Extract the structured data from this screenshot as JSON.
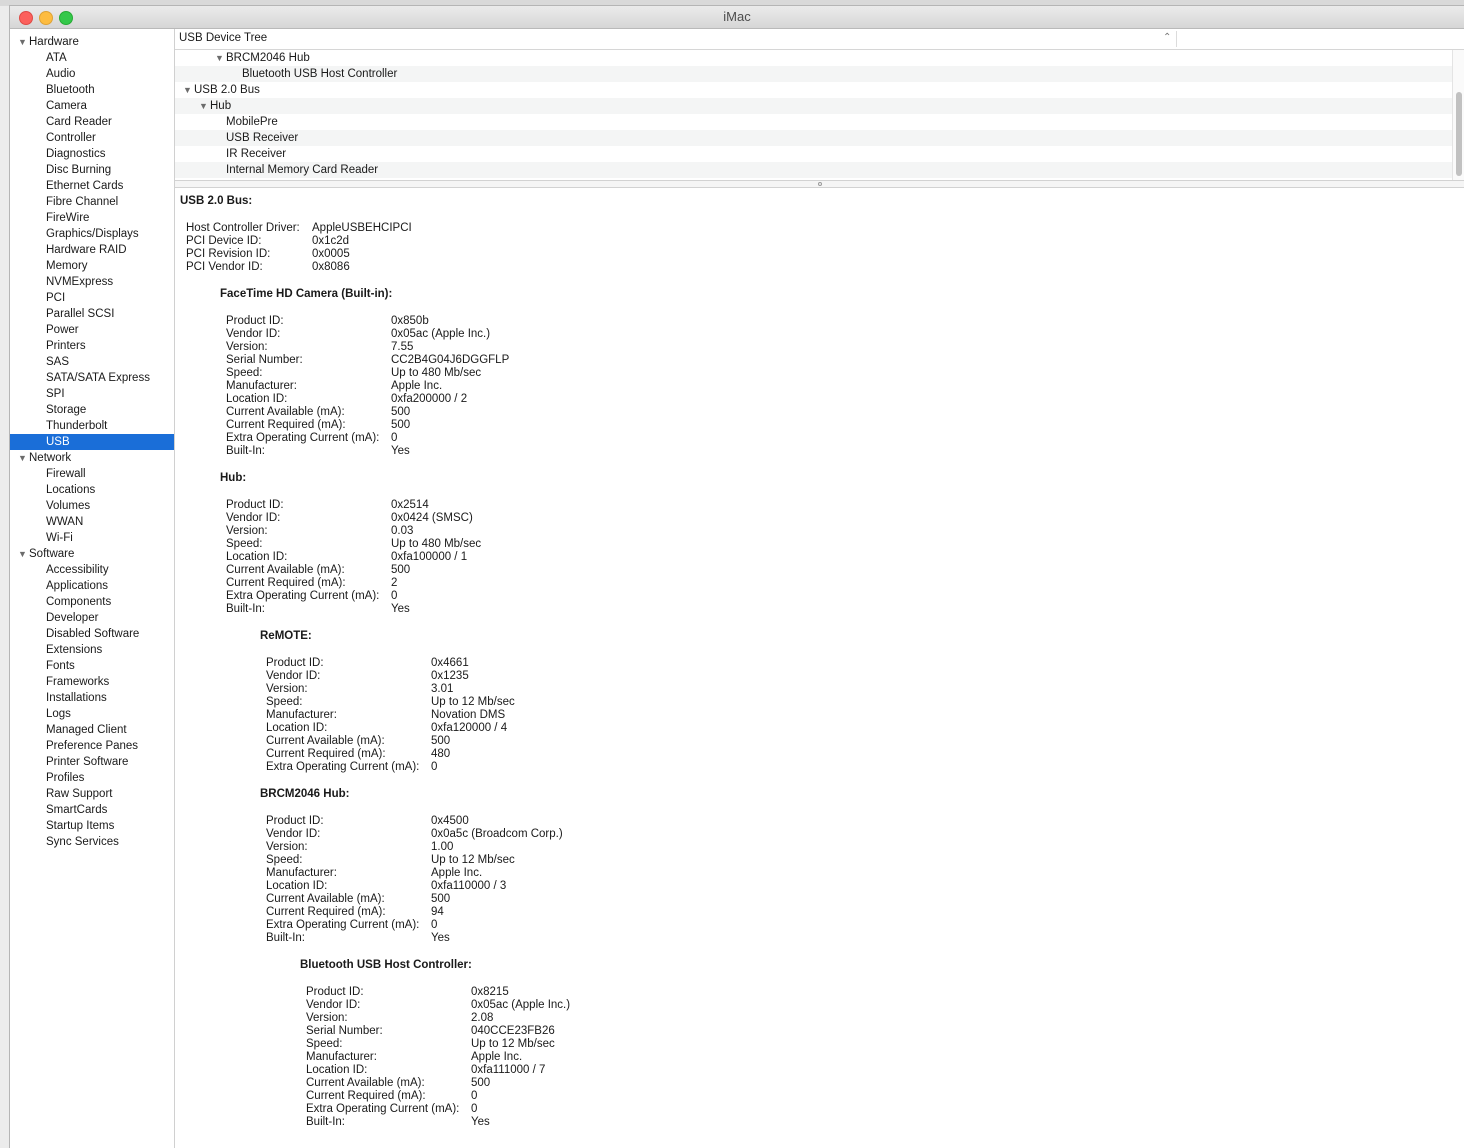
{
  "window": {
    "title": "iMac"
  },
  "sidebar": {
    "groups": [
      {
        "label": "Hardware",
        "items": [
          "ATA",
          "Audio",
          "Bluetooth",
          "Camera",
          "Card Reader",
          "Controller",
          "Diagnostics",
          "Disc Burning",
          "Ethernet Cards",
          "Fibre Channel",
          "FireWire",
          "Graphics/Displays",
          "Hardware RAID",
          "Memory",
          "NVMExpress",
          "PCI",
          "Parallel SCSI",
          "Power",
          "Printers",
          "SAS",
          "SATA/SATA Express",
          "SPI",
          "Storage",
          "Thunderbolt",
          "USB"
        ]
      },
      {
        "label": "Network",
        "items": [
          "Firewall",
          "Locations",
          "Volumes",
          "WWAN",
          "Wi-Fi"
        ]
      },
      {
        "label": "Software",
        "items": [
          "Accessibility",
          "Applications",
          "Components",
          "Developer",
          "Disabled Software",
          "Extensions",
          "Fonts",
          "Frameworks",
          "Installations",
          "Logs",
          "Managed Client",
          "Preference Panes",
          "Printer Software",
          "Profiles",
          "Raw Support",
          "SmartCards",
          "Startup Items",
          "Sync Services"
        ]
      }
    ],
    "selected": "USB"
  },
  "tree": {
    "column_title": "USB Device Tree",
    "rows": [
      {
        "label": "BRCM2046 Hub",
        "level": 2,
        "expanded": true
      },
      {
        "label": "Bluetooth USB Host Controller",
        "level": 3,
        "expanded": null
      },
      {
        "label": "USB 2.0 Bus",
        "level": 0,
        "expanded": true
      },
      {
        "label": "Hub",
        "level": 1,
        "expanded": true
      },
      {
        "label": "MobilePre",
        "level": 2,
        "expanded": null
      },
      {
        "label": "USB Receiver",
        "level": 2,
        "expanded": null
      },
      {
        "label": "IR Receiver",
        "level": 2,
        "expanded": null
      },
      {
        "label": "Internal Memory Card Reader",
        "level": 2,
        "expanded": null
      }
    ]
  },
  "detail": {
    "title": "USB 2.0 Bus:",
    "bus_fields": [
      [
        "Host Controller Driver:",
        "AppleUSBEHCIPCI"
      ],
      [
        "PCI Device ID:",
        "0x1c2d"
      ],
      [
        "PCI Revision ID:",
        "0x0005"
      ],
      [
        "PCI Vendor ID:",
        "0x8086"
      ]
    ],
    "devices": [
      {
        "name": "FaceTime HD Camera (Built-in):",
        "level": 1,
        "fields": [
          [
            "Product ID:",
            "0x850b"
          ],
          [
            "Vendor ID:",
            "0x05ac (Apple Inc.)"
          ],
          [
            "Version:",
            "7.55"
          ],
          [
            "Serial Number:",
            "CC2B4G04J6DGGFLP"
          ],
          [
            "Speed:",
            "Up to 480 Mb/sec"
          ],
          [
            "Manufacturer:",
            "Apple Inc."
          ],
          [
            "Location ID:",
            "0xfa200000 / 2"
          ],
          [
            "Current Available (mA):",
            "500"
          ],
          [
            "Current Required (mA):",
            "500"
          ],
          [
            "Extra Operating Current (mA):",
            "0"
          ],
          [
            "Built-In:",
            "Yes"
          ]
        ]
      },
      {
        "name": "Hub:",
        "level": 1,
        "fields": [
          [
            "Product ID:",
            "0x2514"
          ],
          [
            "Vendor ID:",
            "0x0424  (SMSC)"
          ],
          [
            "Version:",
            "0.03"
          ],
          [
            "Speed:",
            "Up to 480 Mb/sec"
          ],
          [
            "Location ID:",
            "0xfa100000 / 1"
          ],
          [
            "Current Available (mA):",
            "500"
          ],
          [
            "Current Required (mA):",
            "2"
          ],
          [
            "Extra Operating Current (mA):",
            "0"
          ],
          [
            "Built-In:",
            "Yes"
          ]
        ]
      },
      {
        "name": "ReMOTE:",
        "level": 2,
        "fields": [
          [
            "Product ID:",
            "0x4661"
          ],
          [
            "Vendor ID:",
            "0x1235"
          ],
          [
            "Version:",
            "3.01"
          ],
          [
            "Speed:",
            "Up to 12 Mb/sec"
          ],
          [
            "Manufacturer:",
            "Novation DMS"
          ],
          [
            "Location ID:",
            "0xfa120000 / 4"
          ],
          [
            "Current Available (mA):",
            "500"
          ],
          [
            "Current Required (mA):",
            "480"
          ],
          [
            "Extra Operating Current (mA):",
            "0"
          ]
        ]
      },
      {
        "name": "BRCM2046 Hub:",
        "level": 2,
        "fields": [
          [
            "Product ID:",
            "0x4500"
          ],
          [
            "Vendor ID:",
            "0x0a5c  (Broadcom Corp.)"
          ],
          [
            "Version:",
            "1.00"
          ],
          [
            "Speed:",
            "Up to 12 Mb/sec"
          ],
          [
            "Manufacturer:",
            "Apple Inc."
          ],
          [
            "Location ID:",
            "0xfa110000 / 3"
          ],
          [
            "Current Available (mA):",
            "500"
          ],
          [
            "Current Required (mA):",
            "94"
          ],
          [
            "Extra Operating Current (mA):",
            "0"
          ],
          [
            "Built-In:",
            "Yes"
          ]
        ]
      },
      {
        "name": "Bluetooth USB Host Controller:",
        "level": 3,
        "fields": [
          [
            "Product ID:",
            "0x8215"
          ],
          [
            "Vendor ID:",
            "0x05ac (Apple Inc.)"
          ],
          [
            "Version:",
            "2.08"
          ],
          [
            "Serial Number:",
            "040CCE23FB26"
          ],
          [
            "Speed:",
            "Up to 12 Mb/sec"
          ],
          [
            "Manufacturer:",
            "Apple Inc."
          ],
          [
            "Location ID:",
            "0xfa111000 / 7"
          ],
          [
            "Current Available (mA):",
            "500"
          ],
          [
            "Current Required (mA):",
            "0"
          ],
          [
            "Extra Operating Current (mA):",
            "0"
          ],
          [
            "Built-In:",
            "Yes"
          ]
        ]
      }
    ]
  },
  "icons": {
    "disclosure_open": "disclosure-triangle-open-icon",
    "sort": "sort-ascending-icon"
  },
  "colors": {
    "selection": "#1a6ed8",
    "close": "#fc605c",
    "minimize": "#fdbc40",
    "zoom": "#34c84a"
  }
}
